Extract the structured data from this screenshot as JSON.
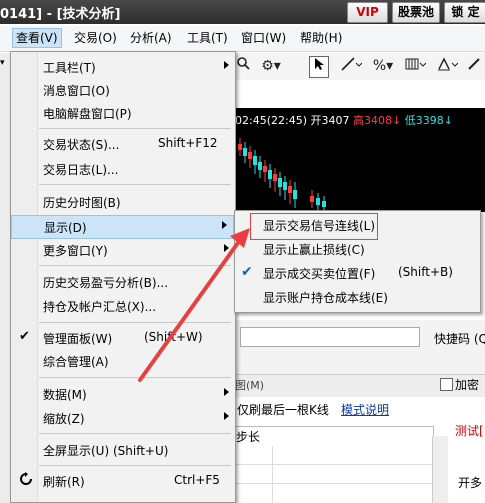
{
  "titlebar": {
    "title": "0141] - [技术分析]",
    "vip": "VIP",
    "stock_pool": "股票池",
    "lock": "锁 定"
  },
  "menubar": {
    "items": [
      "查看(V)",
      "交易(O)",
      "分析(A)",
      "工具(T)",
      "窗口(W)",
      "帮助(H)"
    ]
  },
  "left_strip": {
    "dd_label": "▾"
  },
  "chart": {
    "time": "02:45(22:45)",
    "open": "开3407",
    "high": "高3408",
    "low": "低3398"
  },
  "view_menu": {
    "items": [
      {
        "label": "工具栏(T)",
        "shortcut": "",
        "arrow": true,
        "check": false
      },
      {
        "label": "消息窗口(O)",
        "shortcut": "",
        "arrow": false,
        "check": false
      },
      {
        "label": "电脑解盘窗口(P)",
        "shortcut": "",
        "arrow": false,
        "check": false
      },
      {
        "label": "交易状态(S)...",
        "shortcut": "Shift+F12",
        "arrow": false,
        "check": false
      },
      {
        "label": "交易日志(L)...",
        "shortcut": "",
        "arrow": false,
        "check": false
      },
      {
        "label": "历史分时图(B)",
        "shortcut": "",
        "arrow": false,
        "check": false
      },
      {
        "label": "显示(D)",
        "shortcut": "",
        "arrow": true,
        "check": false
      },
      {
        "label": "更多窗口(Y)",
        "shortcut": "",
        "arrow": true,
        "check": false
      },
      {
        "label": "历史交易盈亏分析(B)...",
        "shortcut": "",
        "arrow": false,
        "check": false
      },
      {
        "label": "持仓及帐户汇总(X)...",
        "shortcut": "",
        "arrow": false,
        "check": false
      },
      {
        "label": "管理面板(W)",
        "shortcut": "(Shift+W)",
        "arrow": false,
        "check": true
      },
      {
        "label": "综合管理(A)",
        "shortcut": "",
        "arrow": false,
        "check": false
      },
      {
        "label": "数据(M)",
        "shortcut": "",
        "arrow": true,
        "check": false
      },
      {
        "label": "缩放(Z)",
        "shortcut": "",
        "arrow": true,
        "check": false
      },
      {
        "label": "全屏显示(U) (Shift+U)",
        "shortcut": "",
        "arrow": false,
        "check": false
      },
      {
        "label": "刷新(R)",
        "shortcut": "Ctrl+F5",
        "arrow": false,
        "check": false
      }
    ]
  },
  "display_submenu": {
    "items": [
      {
        "label": "显示交易信号连线(L)",
        "shortcut": "",
        "check": false
      },
      {
        "label": "显示止赢止损线(C)",
        "shortcut": "",
        "check": false
      },
      {
        "label": "显示成交买卖位置(F)",
        "shortcut": "(Shift+B)",
        "check": true
      },
      {
        "label": "显示账户持仓成本线(E)",
        "shortcut": "",
        "check": false
      }
    ]
  },
  "lower_panel": {
    "quick_code": "快捷码 (Q",
    "tab_fragment": "图(M)",
    "jiami": "加密",
    "only_last_k": "仅刷最后一根K线",
    "model_desc": "模式说明",
    "step": "步长",
    "test": "测试[",
    "kaiduo": "开多"
  },
  "colors": {
    "highlight": "#cce4f7",
    "annotation_red": "#e84040",
    "chart_bg": "#000000",
    "up_red": "#ff3b3b",
    "down_cyan": "#28e0e0"
  }
}
